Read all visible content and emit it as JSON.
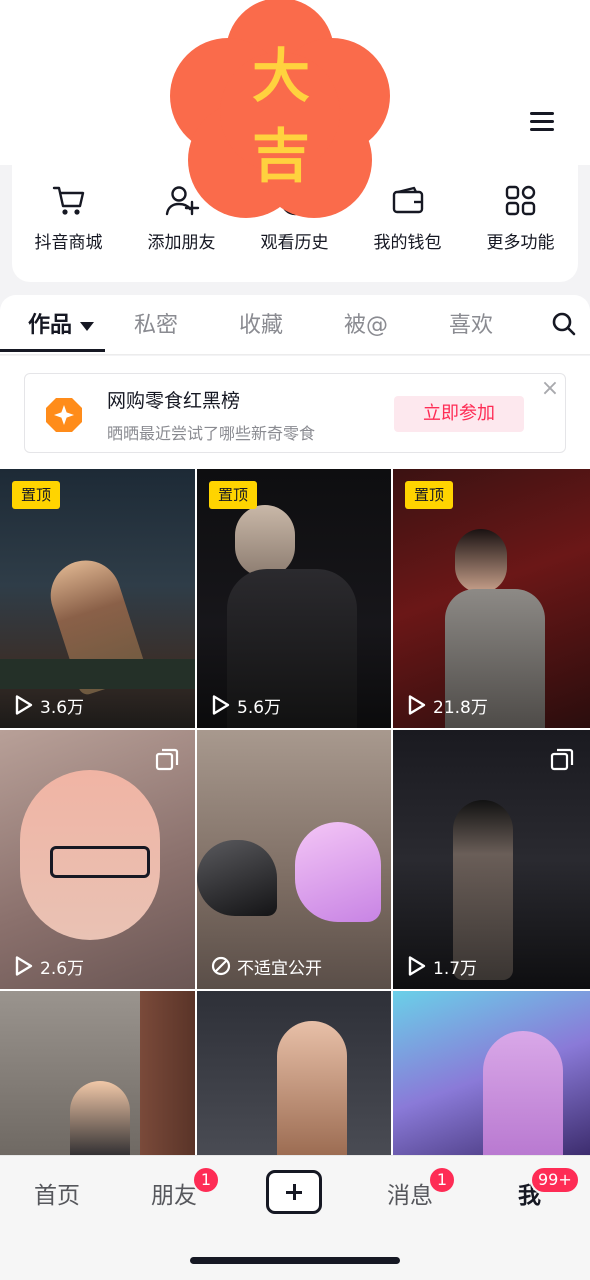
{
  "sticker": {
    "chars": [
      "大",
      "吉"
    ]
  },
  "quick_functions": [
    {
      "label": "抖音商城",
      "icon": "shopping-cart-icon"
    },
    {
      "label": "添加朋友",
      "icon": "add-friend-icon"
    },
    {
      "label": "观看历史",
      "icon": "history-icon"
    },
    {
      "label": "我的钱包",
      "icon": "wallet-icon"
    },
    {
      "label": "更多功能",
      "icon": "grid-icon"
    }
  ],
  "tabs": [
    {
      "label": "作品",
      "active": true
    },
    {
      "label": "私密"
    },
    {
      "label": "收藏"
    },
    {
      "label": "被@"
    },
    {
      "label": "喜欢"
    }
  ],
  "promo": {
    "title": "网购零食红黑榜",
    "subtitle": "晒晒最近尝试了哪些新奇零食",
    "button": "立即参加",
    "close": "×"
  },
  "videos": [
    {
      "pinned": "置顶",
      "views": "3.6万"
    },
    {
      "pinned": "置顶",
      "views": "5.6万"
    },
    {
      "pinned": "置顶",
      "views": "21.8万"
    },
    {
      "views": "2.6万",
      "multi": true
    },
    {
      "views": "不适宜公开",
      "restricted": true
    },
    {
      "views": "1.7万",
      "multi": true
    },
    {},
    {},
    {}
  ],
  "bottom_nav": {
    "home": "首页",
    "friends": "朋友",
    "friends_badge": "1",
    "messages": "消息",
    "messages_badge": "1",
    "me": "我",
    "me_badge": "99+"
  },
  "colors": {
    "accent": "#fe2c55",
    "pin": "#ffd400",
    "sticker": "#fa6b4b",
    "sticker_text": "#ffd23e"
  }
}
